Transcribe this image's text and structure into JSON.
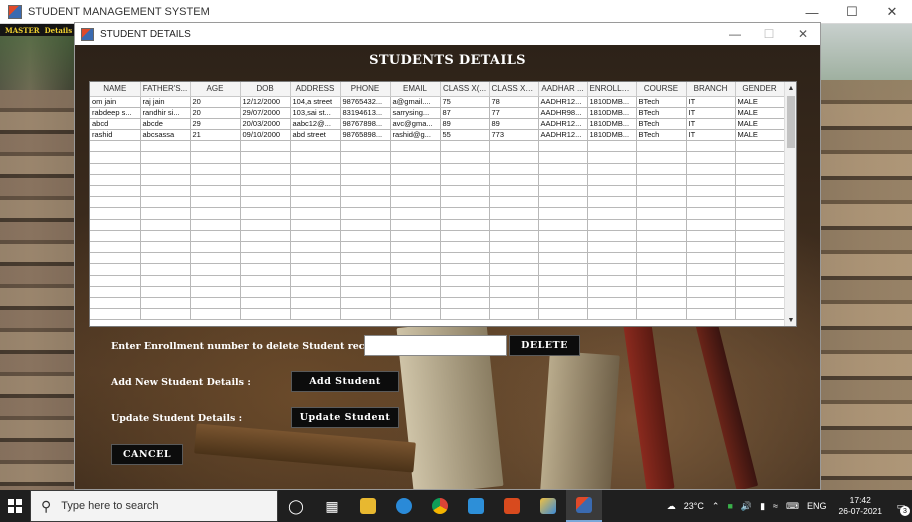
{
  "main_window": {
    "title": "STUDENT MANAGEMENT SYSTEM",
    "menu": [
      "MASTER",
      "Details"
    ],
    "controls": {
      "minimize": "—",
      "maximize": "☐",
      "close": "✕"
    }
  },
  "dialog": {
    "title": "STUDENT DETAILS",
    "heading": "STUDENTS DETAILS",
    "controls": {
      "minimize": "—",
      "maximize": "☐",
      "close": "✕"
    }
  },
  "table": {
    "columns": [
      "NAME",
      "FATHER'S...",
      "AGE",
      "DOB",
      "ADDRESS",
      "PHONE",
      "EMAIL",
      "CLASS X(...",
      "CLASS X1...",
      "AADHAR ...",
      "ENROLLM...",
      "COURSE",
      "BRANCH",
      "GENDER"
    ],
    "rows": [
      [
        "om jain",
        "raj jain",
        "20",
        "12/12/2000",
        "104,a street",
        "98765432...",
        "a@gmail....",
        "75",
        "78",
        "AADHR12...",
        "1810DMB...",
        "BTech",
        "IT",
        "MALE"
      ],
      [
        "rabdeep s...",
        "randhir si...",
        "20",
        "29/07/2000",
        "103,sai st...",
        "83194613...",
        "sarrysing...",
        "87",
        "77",
        "AADHR98...",
        "1810DMB...",
        "BTech",
        "IT",
        "MALE"
      ],
      [
        "abcd",
        "abcde",
        "29",
        "20/03/2000",
        "aabc12@...",
        "98767898...",
        "avc@gma...",
        "89",
        "89",
        "AADHR12...",
        "1810DMB...",
        "BTech",
        "IT",
        "MALE"
      ],
      [
        "rashid",
        "abcsassa",
        "21",
        "09/10/2000",
        "abd street",
        "98765898...",
        "rashid@g...",
        "55",
        "773",
        "AADHR12...",
        "1810DMB...",
        "BTech",
        "IT",
        "MALE"
      ]
    ],
    "empty_rows": 16,
    "scroll_up": "▲",
    "scroll_down": "▼"
  },
  "form": {
    "delete_label": "Enter Enrollment number to delete Student record :",
    "delete_input_value": "",
    "delete_button": "DELETE",
    "add_label": "Add New Student Details :",
    "add_button": "Add Student",
    "update_label": "Update Student Details :",
    "update_button": "Update Student",
    "cancel_button": "CANCEL"
  },
  "taskbar": {
    "search_placeholder": "Type here to search",
    "weather": "23°C",
    "language": "ENG",
    "time": "17:42",
    "date": "26-07-2021",
    "notification_count": "3"
  }
}
